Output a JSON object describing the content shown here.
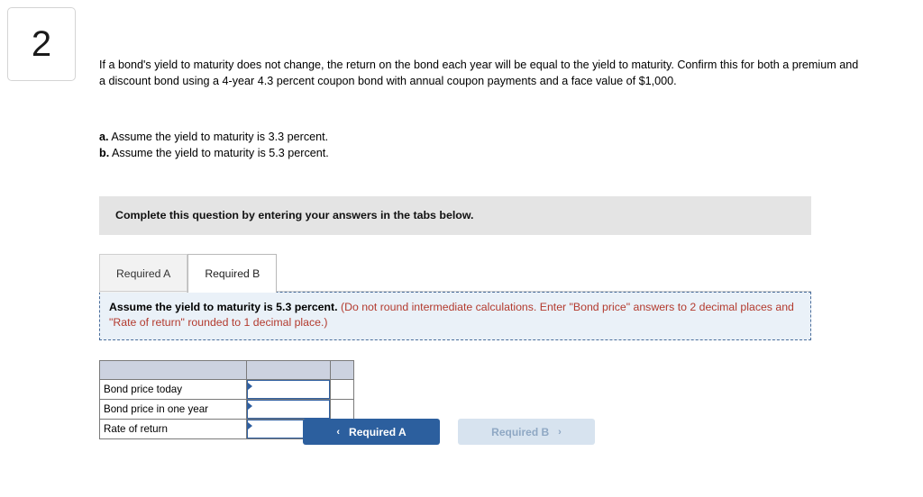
{
  "question": {
    "number": "2",
    "prompt": "If a bond's yield to maturity does not change, the return on the bond each year will be equal to the yield to maturity. Confirm this for both a premium and a discount bond using a 4-year 4.3 percent coupon bond with annual coupon payments and a face value of $1,000.",
    "parts": [
      {
        "label": "a.",
        "text": "Assume the yield to maturity is 3.3 percent."
      },
      {
        "label": "b.",
        "text": "Assume the yield to maturity is 5.3 percent."
      }
    ]
  },
  "instruction_bar": {
    "text": "Complete this question by entering your answers in the tabs below."
  },
  "tabs": [
    {
      "label": "Required A",
      "state": "inactive"
    },
    {
      "label": "Required B",
      "state": "active"
    }
  ],
  "callout": {
    "bold_text": "Assume the yield to maturity is 5.3 percent.",
    "red_text": "(Do not round intermediate calculations. Enter \"Bond price\" answers to 2 decimal places and \"Rate of return\" rounded to 1 decimal place.)"
  },
  "answer_table": {
    "header": "",
    "rows": [
      {
        "label": "Bond price today",
        "value": "",
        "unit": ""
      },
      {
        "label": "Bond price in one year",
        "value": "",
        "unit": ""
      },
      {
        "label": "Rate of return",
        "value": "",
        "unit": "%"
      }
    ]
  },
  "nav": {
    "prev": {
      "label": "Required A",
      "icon": "chevron-left-icon",
      "glyph": "‹"
    },
    "next": {
      "label": "Required B",
      "icon": "chevron-right-icon",
      "glyph": "›"
    }
  },
  "colors": {
    "primary_button": "#2c5f9e",
    "secondary_button": "#d7e3ef",
    "callout_bg": "#eaf1f8",
    "callout_border": "#4a6d9b",
    "red_text": "#b33a2e",
    "table_header": "#ccd2e0",
    "instruction_bar": "#e4e4e4"
  }
}
